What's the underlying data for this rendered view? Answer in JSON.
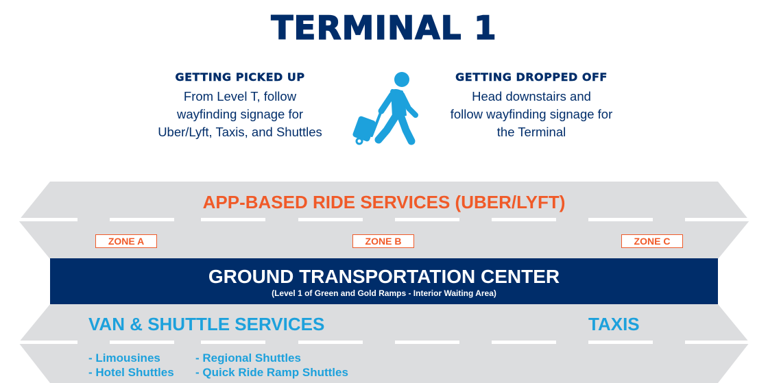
{
  "header": {
    "title": "TERMINAL 1"
  },
  "pickup": {
    "heading": "GETTING PICKED UP",
    "lines": [
      "From Level T, follow",
      "wayfinding signage for",
      "Uber/Lyft, Taxis, and Shuttles"
    ]
  },
  "dropoff": {
    "heading": "GETTING DROPPED OFF",
    "lines": [
      "Head downstairs and",
      "follow wayfinding signage for",
      "the Terminal"
    ]
  },
  "traveler_icon": "person-with-rolling-luggage-icon",
  "app_lane": {
    "title": "APP-BASED RIDE SERVICES (UBER/LYFT)",
    "zones": [
      "ZONE A",
      "ZONE B",
      "ZONE C"
    ]
  },
  "gtc": {
    "title": "GROUND TRANSPORTATION CENTER",
    "subtitle": "(Level 1 of Green and Gold Ramps - Interior Waiting Area)"
  },
  "lower_lane": {
    "van_title": "VAN & SHUTTLE SERVICES",
    "taxi_title": "TAXIS",
    "list_col1": [
      "- Limousines",
      "- Hotel Shuttles"
    ],
    "list_col2": [
      "- Regional Shuttles",
      "- Quick Ride Ramp Shuttles"
    ]
  },
  "colors": {
    "navy": "#002d6a",
    "orange": "#f05a28",
    "sky_blue": "#1da1dc",
    "road_gray": "#dcdddf"
  }
}
